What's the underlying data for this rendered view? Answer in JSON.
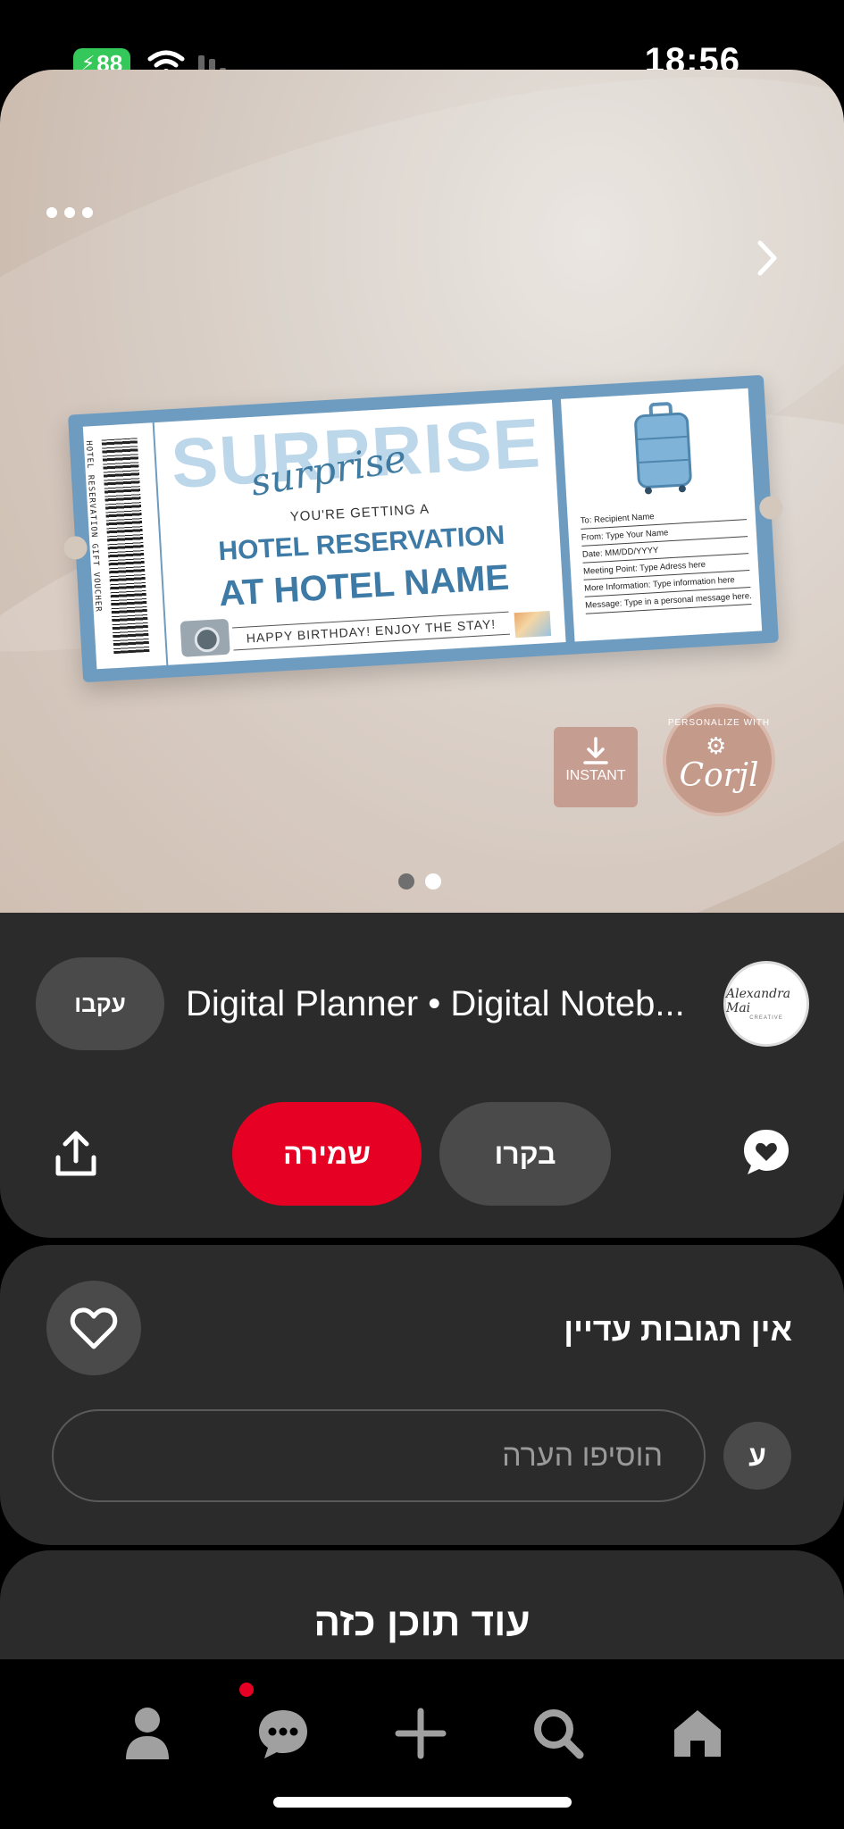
{
  "status_bar": {
    "battery_level": "88",
    "time": "18:56"
  },
  "pin": {
    "ticket": {
      "headline": "SURPRISE",
      "script": "surprise",
      "getting": "YOU'RE GETTING A",
      "line1": "HOTEL RESERVATION",
      "line2": "AT HOTEL NAME",
      "birthday": "HAPPY BIRTHDAY! ENJOY THE STAY!",
      "side_text": "HOTEL RESERVATION GIFT VOUCHER",
      "fields": [
        "To: Recipient Name",
        "From: Type Your Name",
        "Date: MM/DD/YYYY",
        "Meeting Point: Type Adress here",
        "More Information: Type information here",
        "Message: Type in a personal message here."
      ]
    },
    "badge_instant": "INSTANT",
    "badge_corjl_ring": "PERSONALIZE WITH",
    "badge_corjl_word": "Corjl",
    "carousel_total": 2,
    "carousel_active": 2
  },
  "creator": {
    "follow_label": "עקבו",
    "name": "Digital Planner • Digital Noteb...",
    "avatar_signature": "Alexandra Mai",
    "avatar_sub": "CREATIVE"
  },
  "actions": {
    "save_label": "שמירה",
    "visit_label": "בקרו"
  },
  "comments": {
    "empty_label": "אין תגובות עדיין",
    "input_placeholder": "הוסיפו הערה",
    "user_initial": "ע"
  },
  "more": {
    "title": "עוד תוכן כזה"
  },
  "tabbar": {
    "items": [
      "profile",
      "messages",
      "create",
      "search",
      "home"
    ],
    "messages_has_notification": true
  },
  "colors": {
    "accent": "#e60023",
    "panel": "#2b2b2b",
    "button_secondary": "#4a4a4a",
    "ticket_blue": "#6d9cc0",
    "battery_green": "#34c759"
  }
}
